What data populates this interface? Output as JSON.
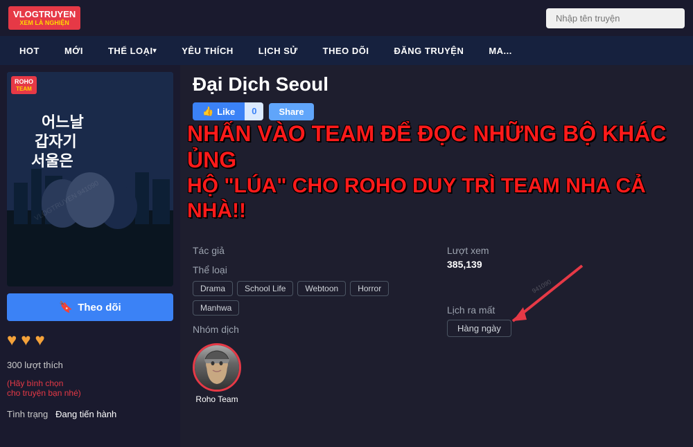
{
  "site": {
    "logo_main": "VLOGTRUYEN",
    "logo_sub": "XEM LÀ NGHIỆN",
    "search_placeholder": "Nhập tên truyện"
  },
  "nav": {
    "items": [
      {
        "label": "HOT",
        "has_arrow": false
      },
      {
        "label": "MỚI",
        "has_arrow": false
      },
      {
        "label": "THỂ LOẠI",
        "has_arrow": true
      },
      {
        "label": "YÊU THÍCH",
        "has_arrow": false
      },
      {
        "label": "LỊCH SỬ",
        "has_arrow": false
      },
      {
        "label": "THEO DÕI",
        "has_arrow": false
      },
      {
        "label": "ĐĂNG TRUYỆN",
        "has_arrow": false
      },
      {
        "label": "MA...",
        "has_arrow": false
      }
    ]
  },
  "manga": {
    "title": "Đại Dịch Seoul",
    "cover_kr": "어느날\n갑자기\n서울은",
    "cover_badge": "ROHO\nTEAM",
    "watermark": "VLOGTRUYEN\n941090",
    "like_label": "Like",
    "like_count": "0",
    "share_label": "Share",
    "follow_label": "Theo dõi",
    "tac_gia_label": "Tác giả",
    "tac_gia_value": "",
    "the_loai_label": "Thể loại",
    "tags": [
      "Drama",
      "School Life",
      "Webtoon",
      "Horror",
      "Manhwa"
    ],
    "nhom_dich_label": "Nhóm dịch",
    "translator_name": "Roho Team",
    "luot_xem_label": "Lượt xem",
    "luot_xem_value": "385,139",
    "lich_ra_mat_label": "Lịch ra mất",
    "lich_ra_mat_value": "Hàng ngày",
    "hearts_count": 3,
    "like_count_300": "300 lượt thích",
    "vote_hint": "(Hãy bình chọn\ncho truyện bạn nhé)",
    "tinh_trang_label": "Tình trạng",
    "tinh_trang_value": "Đang tiến hành",
    "overlay_line1": "NHẤN VÀO TEAM ĐỂ ĐỌC NHỮNG BỘ KHÁC ỦNG",
    "overlay_line2": "HỘ \"LÚA\" CHO ROHO DUY TRÌ TEAM NHA CẢ NHÀ!!"
  }
}
